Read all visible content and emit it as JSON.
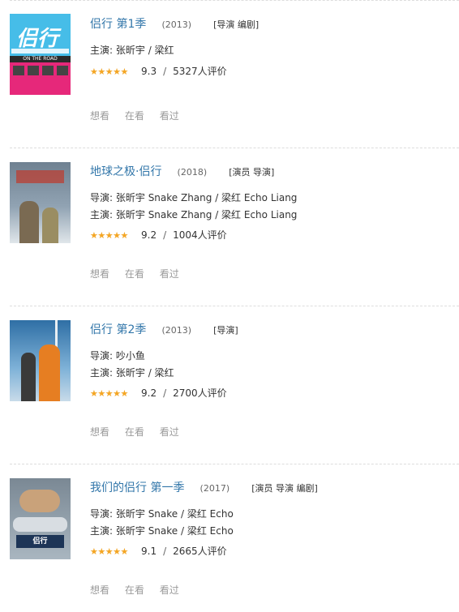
{
  "items": [
    {
      "title": "侣行 第1季",
      "year": "(2013)",
      "roles": "[导演 编剧]",
      "credits": [
        {
          "label": "主演:",
          "value": "张昕宇 / 梁红"
        }
      ],
      "rating": {
        "stars": 5,
        "score": "9.3",
        "count": "5327人评价"
      },
      "actions": [
        "想看",
        "在看",
        "看过"
      ],
      "poster": {
        "caption": "侣行",
        "road": "ON THE ROAD"
      }
    },
    {
      "title": "地球之极·侣行",
      "year": "(2018)",
      "roles": "[演员 导演]",
      "credits": [
        {
          "label": "导演:",
          "value": "张昕宇 Snake Zhang / 梁红 Echo Liang"
        },
        {
          "label": "主演:",
          "value": "张昕宇 Snake Zhang / 梁红 Echo Liang"
        }
      ],
      "rating": {
        "stars": 4.5,
        "score": "9.2",
        "count": "1004人评价"
      },
      "actions": [
        "想看",
        "在看",
        "看过"
      ]
    },
    {
      "title": "侣行 第2季",
      "year": "(2013)",
      "roles": "[导演]",
      "credits": [
        {
          "label": "导演:",
          "value": "吵小鱼"
        },
        {
          "label": "主演:",
          "value": "张昕宇 / 梁红"
        }
      ],
      "rating": {
        "stars": 4.5,
        "score": "9.2",
        "count": "2700人评价"
      },
      "actions": [
        "想看",
        "在看",
        "看过"
      ]
    },
    {
      "title": "我们的侣行 第一季",
      "year": "(2017)",
      "roles": "[演员 导演 编剧]",
      "credits": [
        {
          "label": "导演:",
          "value": "张昕宇 Snake / 梁红 Echo"
        },
        {
          "label": "主演:",
          "value": "张昕宇 Snake / 梁红 Echo"
        }
      ],
      "rating": {
        "stars": 4.5,
        "score": "9.1",
        "count": "2665人评价"
      },
      "actions": [
        "想看",
        "在看",
        "看过"
      ],
      "poster": {
        "logo": "侣行"
      }
    }
  ],
  "colors": {
    "title": "#3377aa",
    "star": "#f5a623",
    "action": "#9b9b9b",
    "divider": "#dddddd"
  }
}
